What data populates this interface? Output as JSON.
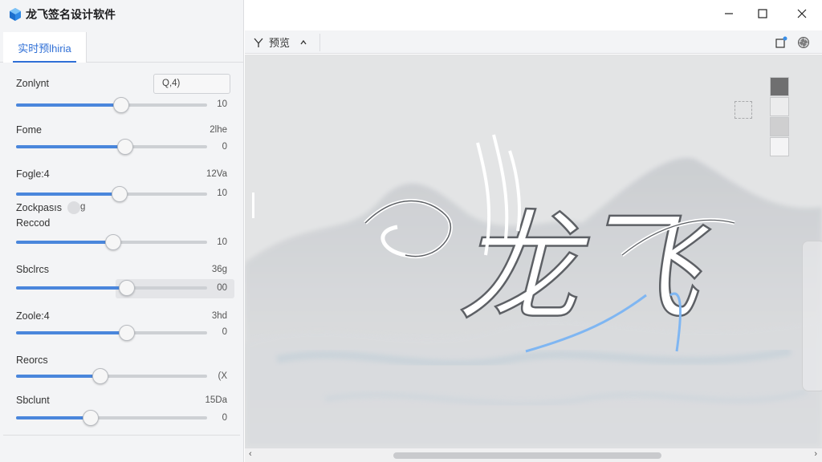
{
  "app": {
    "title": "龙飞签名设计软件",
    "accent_color": "#2f6fd6",
    "slider_fill_color": "#4a86dc"
  },
  "tabs": [
    {
      "label": "实时预lhiria",
      "active": true
    }
  ],
  "params": [
    {
      "label": "Zonlynt",
      "input_value": "Q,4)",
      "value": "10",
      "fill_fraction": 0.55
    },
    {
      "label": "Fome",
      "extra": "2lhe",
      "value": "0",
      "fill_fraction": 0.57
    },
    {
      "label": "Fogle:4",
      "extra": "12Va",
      "value": "10",
      "fill_fraction": 0.54
    },
    {
      "label": "Zockpasıs",
      "label2": "Reccod",
      "extra": "g",
      "value": "10",
      "fill_fraction": 0.51
    },
    {
      "label": "Sbclrcs",
      "extra": "36g",
      "value": "00",
      "fill_fraction": 0.58
    },
    {
      "label": "Zoole:4",
      "extra": "3hd",
      "value": "0",
      "fill_fraction": 0.58
    },
    {
      "label": "Reorcs",
      "value": "(X",
      "fill_fraction": 0.44
    },
    {
      "label": "Sbclunt",
      "extra": "15Da",
      "value": "0",
      "fill_fraction": 0.39
    }
  ],
  "window": {
    "minimize_icon": "minimize-icon",
    "maximize_icon": "maximize-icon",
    "close_icon": "close-icon"
  },
  "toolbar": {
    "preview_label": "预览",
    "preview_icon": "pen-icon",
    "new_window_icon": "window-icon",
    "settings_icon": "aperture-icon",
    "notification_color": "#3a8ee6"
  },
  "swatches": [
    "#6f6f70",
    "#ececed",
    "#cfcfd0",
    "#f4f4f5"
  ],
  "canvas": {
    "signature_text": "龙飞",
    "signature_color": "#ffffff",
    "highlight_color": "#7fb6f2"
  }
}
